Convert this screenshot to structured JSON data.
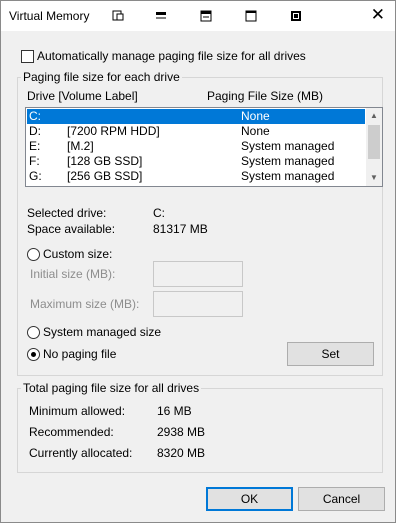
{
  "window": {
    "title": "Virtual Memory",
    "close": "✕"
  },
  "auto_manage": {
    "label": "Automatically manage paging file size for all drives",
    "checked": false
  },
  "paging_group": {
    "legend": "Paging file size for each drive",
    "col_drive": "Drive  [Volume Label]",
    "col_size": "Paging File Size (MB)",
    "rows": [
      {
        "drive": "C:",
        "label": "",
        "size": "None",
        "selected": true
      },
      {
        "drive": "D:",
        "label": "[7200 RPM HDD]",
        "size": "None",
        "selected": false
      },
      {
        "drive": "E:",
        "label": "[M.2]",
        "size": "System managed",
        "selected": false
      },
      {
        "drive": "F:",
        "label": "[128 GB SSD]",
        "size": "System managed",
        "selected": false
      },
      {
        "drive": "G:",
        "label": "[256 GB SSD]",
        "size": "System managed",
        "selected": false
      }
    ],
    "selected_drive_label": "Selected drive:",
    "selected_drive_value": "C:",
    "space_label": "Space available:",
    "space_value": "81317 MB",
    "custom_size_label": "Custom size:",
    "initial_label": "Initial size (MB):",
    "initial_value": "",
    "maximum_label": "Maximum size (MB):",
    "maximum_value": "",
    "system_managed_label": "System managed size",
    "no_paging_label": "No paging file",
    "set_button": "Set"
  },
  "total_group": {
    "legend": "Total paging file size for all drives",
    "minimum_label": "Minimum allowed:",
    "minimum_value": "16 MB",
    "recommended_label": "Recommended:",
    "recommended_value": "2938 MB",
    "allocated_label": "Currently allocated:",
    "allocated_value": "8320 MB"
  },
  "buttons": {
    "ok": "OK",
    "cancel": "Cancel"
  },
  "colors": {
    "selection": "#0078d7",
    "window_bg": "#f0f0f0"
  }
}
